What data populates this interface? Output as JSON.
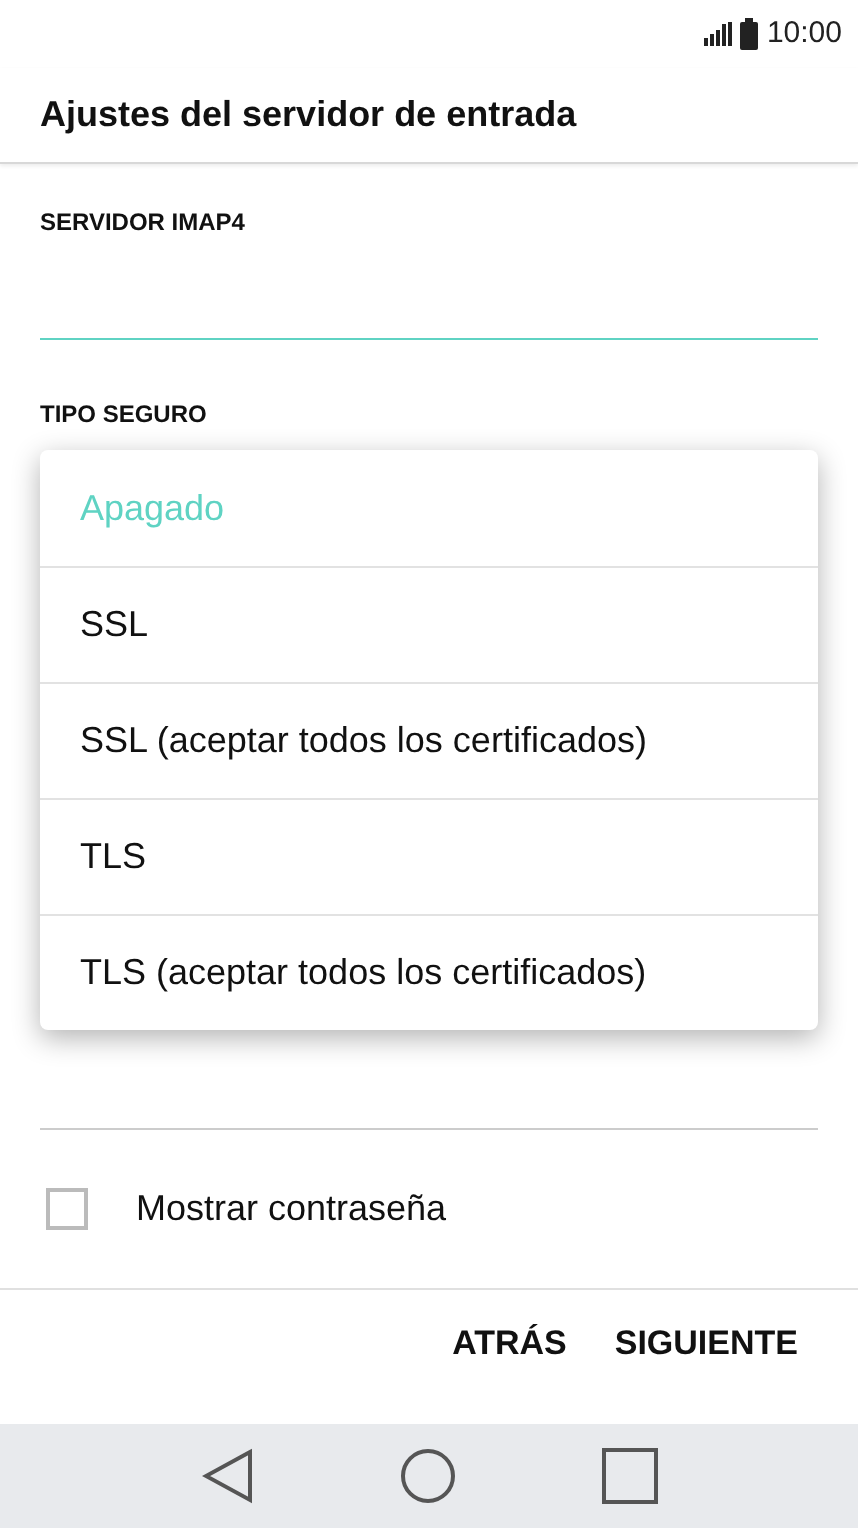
{
  "status_bar": {
    "time": "10:00"
  },
  "title": "Ajustes del servidor de entrada",
  "fields": [
    {
      "label": "SERVIDOR IMAP4",
      "focused": true
    },
    {
      "label": "TIPO SEGURO",
      "focused": false
    }
  ],
  "dropdown": {
    "options": [
      {
        "label": "Apagado",
        "selected": true
      },
      {
        "label": "SSL",
        "selected": false
      },
      {
        "label": "SSL (aceptar todos los certificados)",
        "selected": false
      },
      {
        "label": "TLS",
        "selected": false
      },
      {
        "label": "TLS (aceptar todos los certificados)",
        "selected": false
      }
    ]
  },
  "show_password": {
    "label": "Mostrar contraseña",
    "checked": false
  },
  "buttons": [
    "ATRÁS",
    "SIGUIENTE"
  ]
}
